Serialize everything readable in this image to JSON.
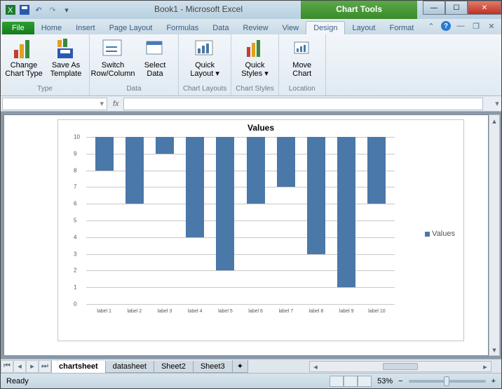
{
  "app": {
    "title": "Book1  -  Microsoft Excel",
    "contextual_tab": "Chart Tools"
  },
  "tabs": {
    "file": "File",
    "home": "Home",
    "insert": "Insert",
    "page_layout": "Page Layout",
    "formulas": "Formulas",
    "data": "Data",
    "review": "Review",
    "view": "View",
    "design": "Design",
    "layout": "Layout",
    "format": "Format"
  },
  "ribbon": {
    "groups": {
      "type": "Type",
      "data": "Data",
      "layouts": "Chart Layouts",
      "styles": "Chart Styles",
      "location": "Location"
    },
    "buttons": {
      "change_type_l1": "Change",
      "change_type_l2": "Chart Type",
      "save_template_l1": "Save As",
      "save_template_l2": "Template",
      "switch_l1": "Switch",
      "switch_l2": "Row/Column",
      "select_l1": "Select",
      "select_l2": "Data",
      "quick_layout_l1": "Quick",
      "quick_layout_l2": "Layout",
      "quick_styles_l1": "Quick",
      "quick_styles_l2": "Styles",
      "move_l1": "Move",
      "move_l2": "Chart"
    }
  },
  "formula_bar": {
    "name_box": "",
    "fx": "fx"
  },
  "sheet_tabs": {
    "s1": "chartsheet",
    "s2": "datasheet",
    "s3": "Sheet2",
    "s4": "Sheet3"
  },
  "status": {
    "ready": "Ready",
    "zoom": "53%"
  },
  "chart_data": {
    "type": "bar",
    "title": "Values",
    "series_name": "Values",
    "ylim": [
      0,
      10
    ],
    "yticks": [
      0,
      1,
      2,
      3,
      4,
      5,
      6,
      7,
      8,
      9,
      10
    ],
    "categories": [
      "label 1",
      "label 2",
      "label 3",
      "label 4",
      "label 5",
      "label 6",
      "label 7",
      "label 8",
      "label 9",
      "label 10"
    ],
    "values": [
      2,
      4,
      1,
      6,
      8,
      4,
      3,
      7,
      9,
      4
    ]
  }
}
